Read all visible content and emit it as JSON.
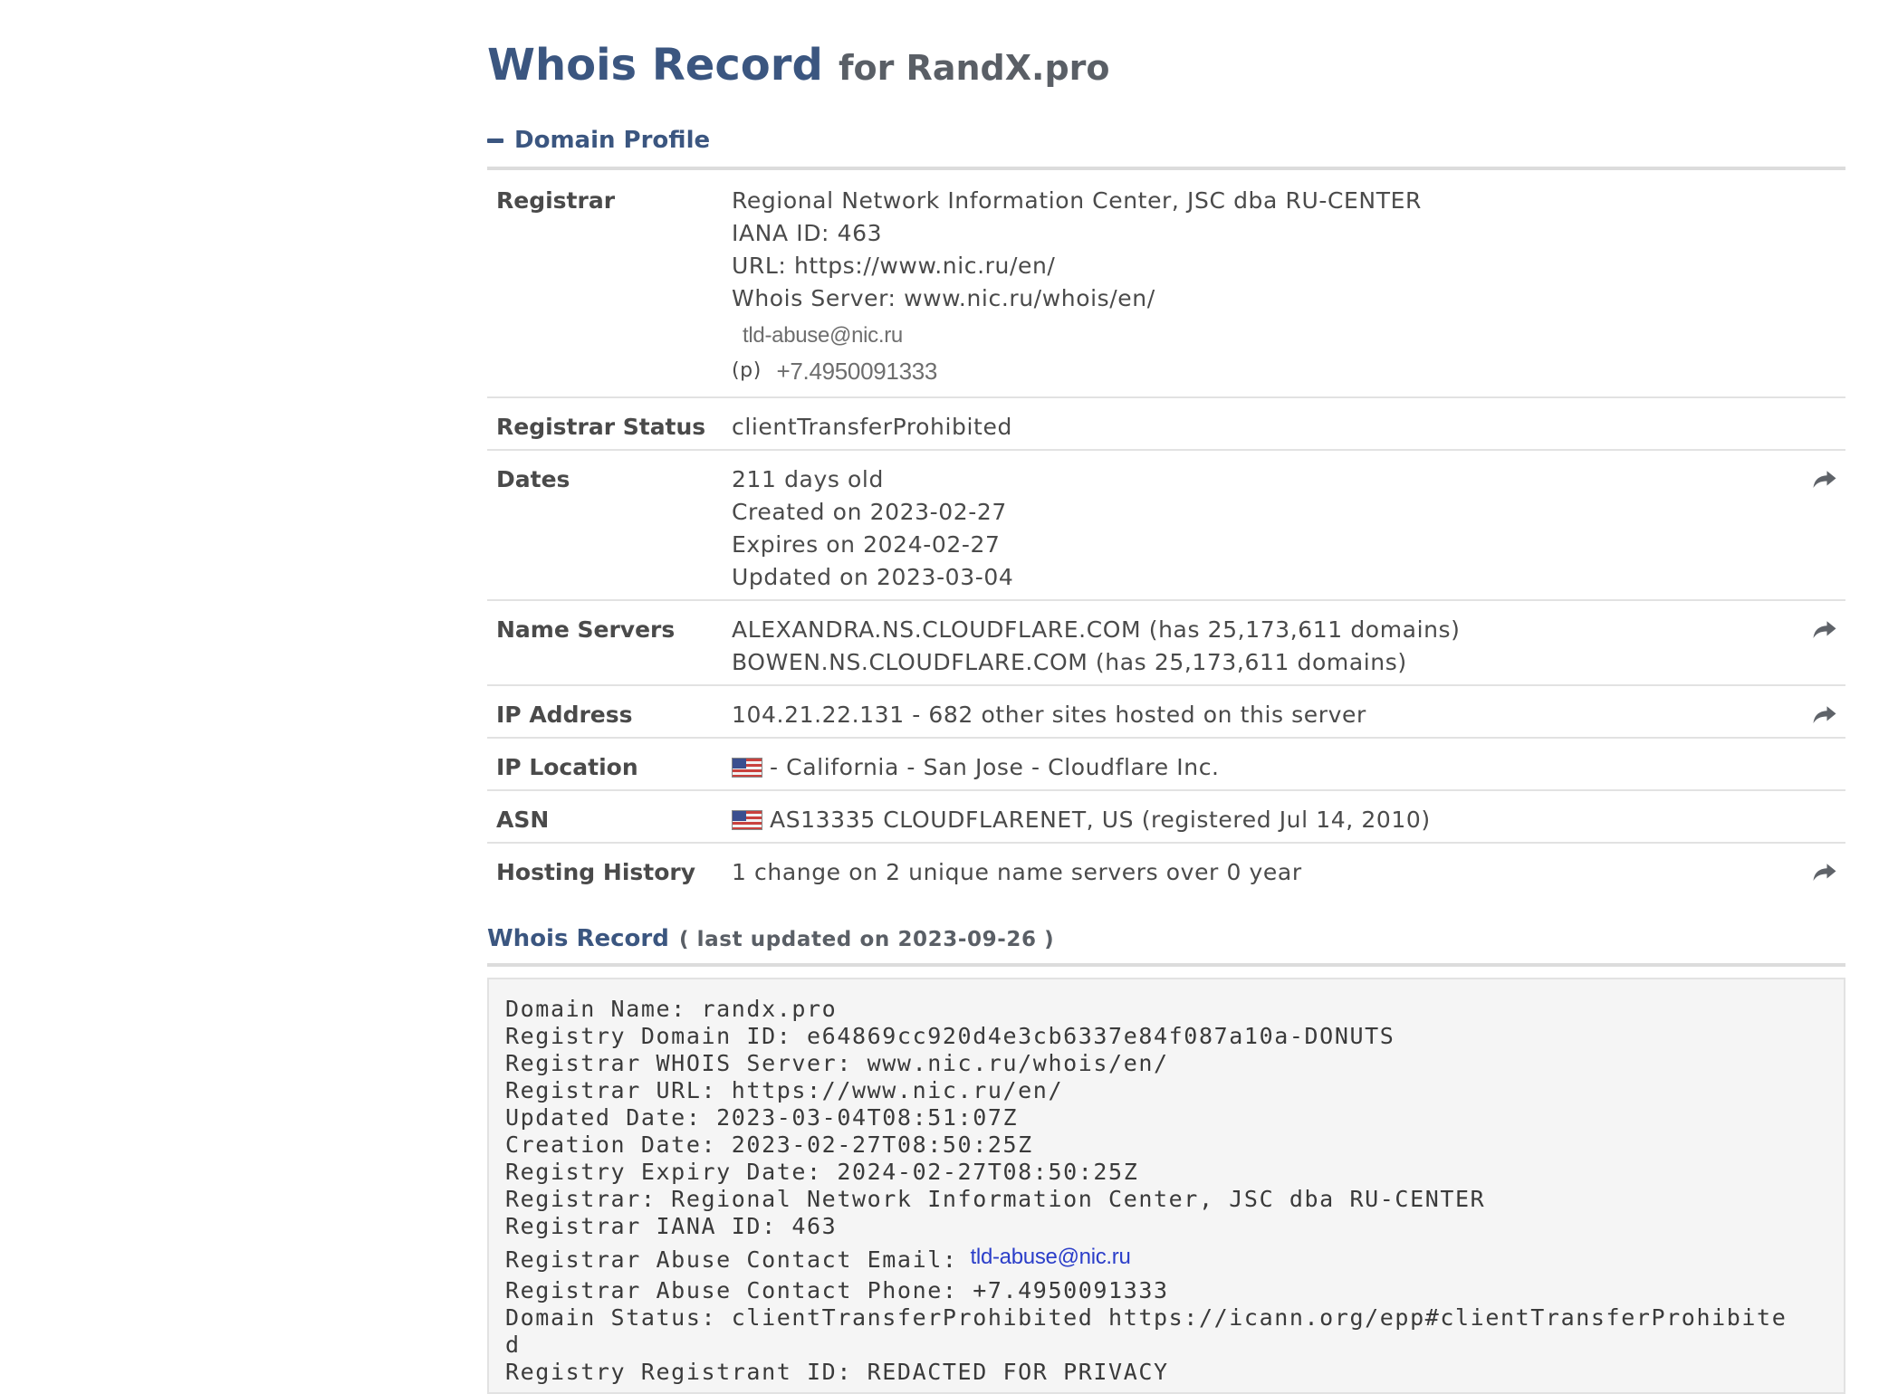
{
  "title": {
    "main": "Whois Record",
    "sub": "for RandX.pro"
  },
  "domain_profile": {
    "header": "Domain Profile",
    "rows": {
      "registrar": {
        "label": "Registrar",
        "name": "Regional Network Information Center, JSC dba RU-CENTER",
        "iana": "IANA ID: 463",
        "url": "URL: https://www.nic.ru/en/",
        "whois_server": "Whois Server: www.nic.ru/whois/en/",
        "email": "tld-abuse@nic.ru",
        "phone_prefix": "(p)",
        "phone": "+7.4950091333"
      },
      "status": {
        "label": "Registrar Status",
        "value": "clientTransferProhibited"
      },
      "dates": {
        "label": "Dates",
        "age": "211 days old",
        "created": "Created on 2023-02-27",
        "expires": "Expires on 2024-02-27",
        "updated": "Updated on 2023-03-04"
      },
      "name_servers": {
        "label": "Name Servers",
        "ns1": "ALEXANDRA.NS.CLOUDFLARE.COM (has 25,173,611 domains)",
        "ns2": "BOWEN.NS.CLOUDFLARE.COM (has 25,173,611 domains)"
      },
      "ip_address": {
        "label": "IP Address",
        "value": "104.21.22.131 - 682 other sites hosted on this server"
      },
      "ip_location": {
        "label": "IP Location",
        "value": "- California - San Jose - Cloudflare Inc."
      },
      "asn": {
        "label": "ASN",
        "value": "AS13335 CLOUDFLARENET, US (registered Jul 14, 2010)"
      },
      "hosting_history": {
        "label": "Hosting History",
        "value": "1 change on 2 unique name servers over 0 year"
      }
    }
  },
  "whois_record": {
    "title": "Whois Record",
    "updated": "( last updated on 2023-09-26 )",
    "lines": [
      "Domain Name: randx.pro",
      "Registry Domain ID: e64869cc920d4e3cb6337e84f087a10a-DONUTS",
      "Registrar WHOIS Server: www.nic.ru/whois/en/",
      "Registrar URL: https://www.nic.ru/en/",
      "Updated Date: 2023-03-04T08:51:07Z",
      "Creation Date: 2023-02-27T08:50:25Z",
      "Registry Expiry Date: 2024-02-27T08:50:25Z",
      "Registrar: Regional Network Information Center, JSC dba RU-CENTER",
      "Registrar IANA ID: 463"
    ],
    "abuse_email_label": "Registrar Abuse Contact Email:",
    "abuse_email": "tld-abuse@nic.ru",
    "lines_after": [
      "Registrar Abuse Contact Phone: +7.4950091333",
      "Domain Status: clientTransferProhibited https://icann.org/epp#clientTransferProhibite",
      "d",
      "Registry Registrant ID: REDACTED FOR PRIVACY"
    ]
  },
  "colors": {
    "accent": "#3b5680",
    "rule": "#dcdcdc",
    "raw_background": "#f5f5f5",
    "email_link": "#2b3ec9"
  },
  "icons": {
    "collapse": "minus-icon",
    "share": "share-arrow-icon",
    "flag": "us-flag-icon"
  }
}
